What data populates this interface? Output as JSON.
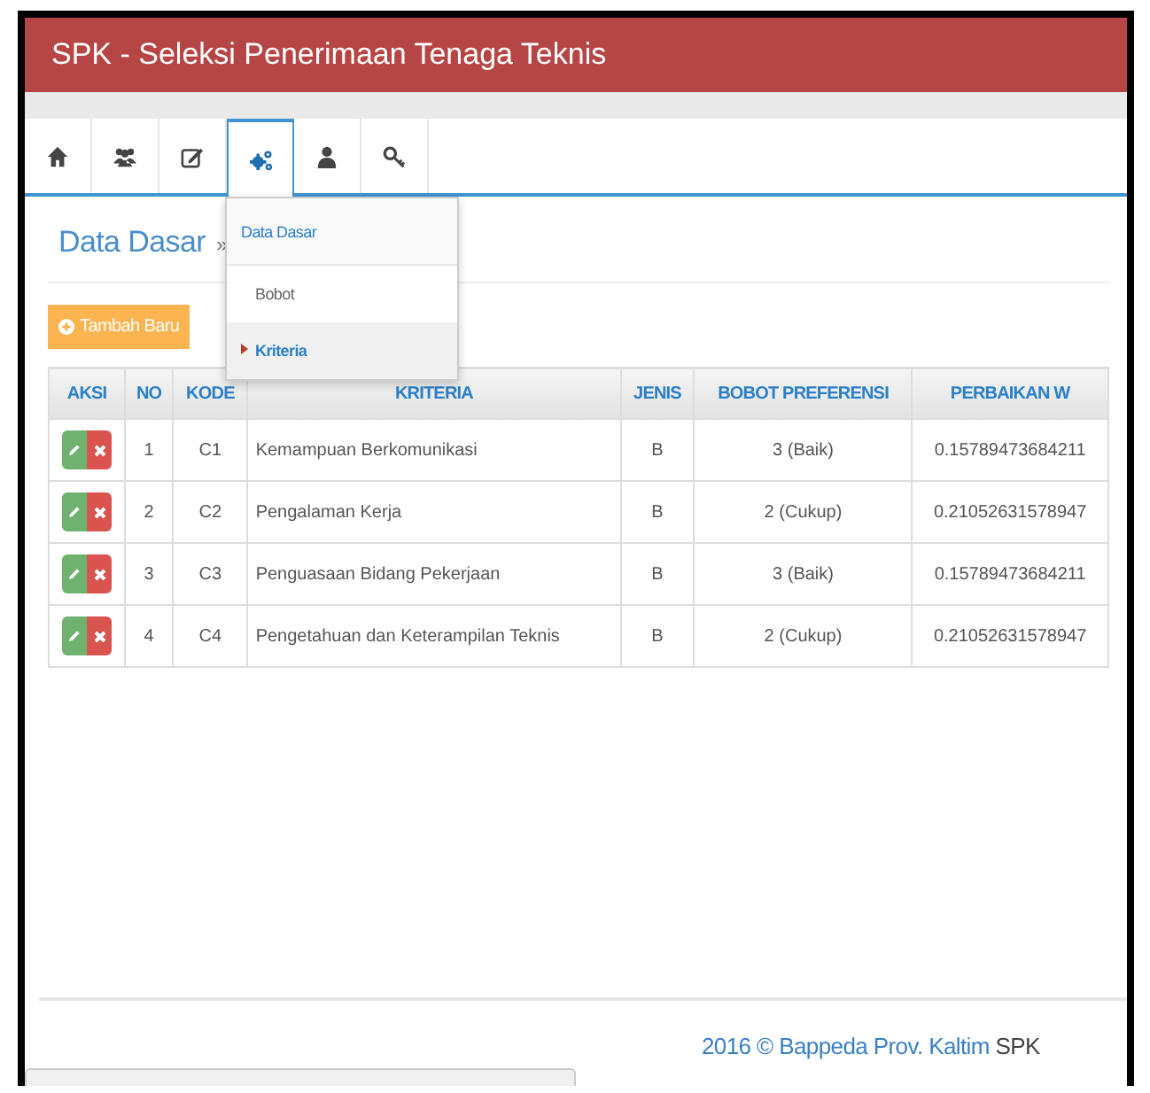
{
  "window": {
    "title": "SPK - Seleksi Penerimaan Tenaga Teknis"
  },
  "nav": [
    {
      "kind": "home",
      "selected": false
    },
    {
      "kind": "users",
      "selected": false
    },
    {
      "kind": "edit",
      "selected": false
    },
    {
      "kind": "gears",
      "selected": true
    },
    {
      "kind": "user",
      "selected": false
    },
    {
      "kind": "key",
      "selected": false
    }
  ],
  "dropdown": [
    {
      "kind": "header",
      "label": "Data Dasar",
      "selected": false
    },
    {
      "kind": "item",
      "label": "Bobot",
      "selected": false
    },
    {
      "kind": "item",
      "label": "Kriteria",
      "selected": true
    }
  ],
  "page": {
    "title": "Data Dasar",
    "separator": "»"
  },
  "add_button": {
    "label": "Tambah Baru"
  },
  "table": {
    "columns": [
      "AKSI",
      "NO",
      "KODE",
      "KRITERIA",
      "JENIS",
      "BOBOT PREFERENSI",
      "PERBAIKAN W"
    ],
    "rows": [
      {
        "no": "1",
        "kode": "C1",
        "kriteria": "Kemampuan Berkomunikasi",
        "jenis": "B",
        "bobot": "3 (Baik)",
        "perbaikan": "0.15789473684211"
      },
      {
        "no": "2",
        "kode": "C2",
        "kriteria": "Pengalaman Kerja",
        "jenis": "B",
        "bobot": "2 (Cukup)",
        "perbaikan": "0.21052631578947"
      },
      {
        "no": "3",
        "kode": "C3",
        "kriteria": "Penguasaan Bidang Pekerjaan",
        "jenis": "B",
        "bobot": "3 (Baik)",
        "perbaikan": "0.15789473684211"
      },
      {
        "no": "4",
        "kode": "C4",
        "kriteria": "Pengetahuan dan Keterampilan Teknis",
        "jenis": "B",
        "bobot": "2 (Cukup)",
        "perbaikan": "0.21052631578947"
      }
    ]
  },
  "footer": {
    "link": "2016 © Bappeda Prov. Kaltim",
    "suffix": "SPK"
  }
}
